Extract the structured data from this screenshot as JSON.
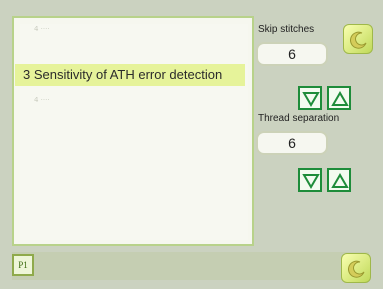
{
  "list": {
    "selected_item": "3 Sensitivity of ATH error detection",
    "faint_item_1": "4 ····",
    "faint_item_2": "4 ····"
  },
  "settings": {
    "skip_stitches": {
      "label": "Skip stitches",
      "value": "6"
    },
    "thread_separation": {
      "label": "Thread separation",
      "value": "6"
    }
  },
  "footer": {
    "page_tab": "P1"
  },
  "icons": {
    "down_arrow": "down-arrow-icon",
    "up_arrow": "up-arrow-icon",
    "moon": "moon-icon"
  },
  "colors": {
    "selection": "#e6f39a",
    "arrow_green": "#1e8c3a",
    "panel_border": "#b8d28a"
  }
}
